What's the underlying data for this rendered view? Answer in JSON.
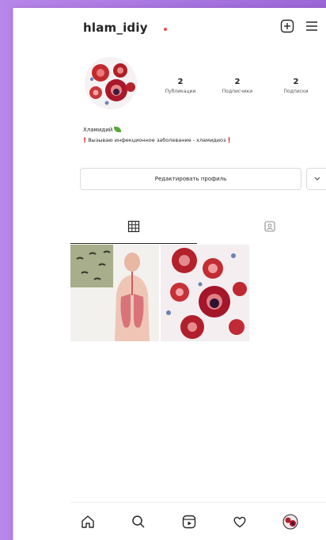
{
  "header": {
    "username": "hlam_idiy",
    "icons": [
      "new-post-icon",
      "menu-icon"
    ]
  },
  "profile": {
    "stats": [
      {
        "value": "2",
        "label": "Публикации"
      },
      {
        "value": "2",
        "label": "Подписчики"
      },
      {
        "value": "2",
        "label": "Подписки"
      }
    ],
    "name": "Хламидий",
    "bio": "Вызываю инфекционное заболевание - хламидиоз",
    "edit_profile_label": "Редактировать профиль"
  },
  "tabs": [
    {
      "name": "grid",
      "icon": "grid-icon",
      "active": true
    },
    {
      "name": "tagged",
      "icon": "tagged-icon",
      "active": false
    }
  ],
  "posts": [
    {
      "icon": "respiratory-system-illustration"
    },
    {
      "icon": "infected-cells-microscopy"
    }
  ],
  "bottom_nav": [
    "home-icon",
    "search-icon",
    "reels-icon",
    "heart-icon",
    "profile-avatar"
  ],
  "colors": {
    "background": "#b887ea",
    "accent_red": "#e0242a",
    "text": "#262626",
    "border": "#dbdbdb"
  }
}
